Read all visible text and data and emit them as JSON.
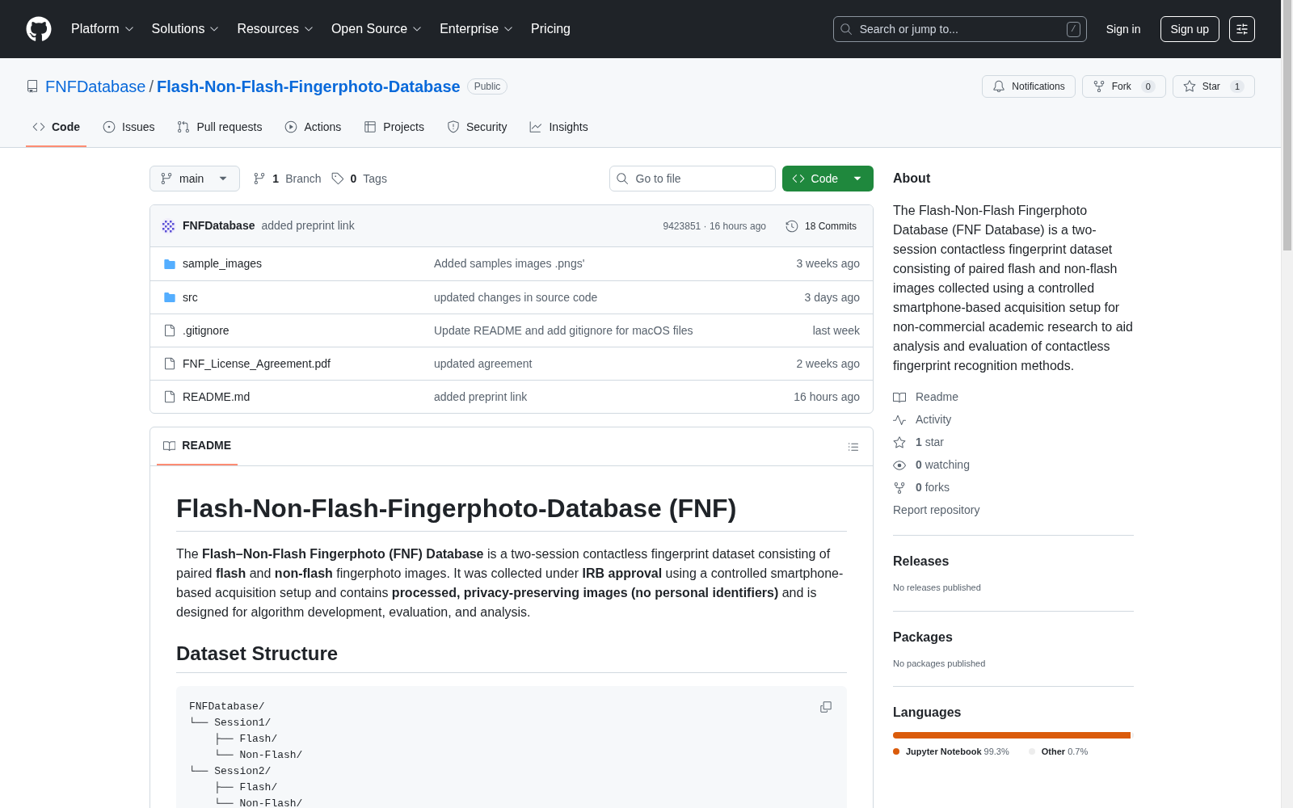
{
  "top_nav": {
    "items": [
      {
        "label": "Platform",
        "dropdown": true
      },
      {
        "label": "Solutions",
        "dropdown": true
      },
      {
        "label": "Resources",
        "dropdown": true
      },
      {
        "label": "Open Source",
        "dropdown": true
      },
      {
        "label": "Enterprise",
        "dropdown": true
      },
      {
        "label": "Pricing",
        "dropdown": false
      }
    ],
    "search": {
      "placeholder": "Search or jump to...",
      "shortcut": "/"
    },
    "sign_in": "Sign in",
    "sign_up": "Sign up"
  },
  "repo": {
    "owner": "FNFDatabase",
    "separator": "/",
    "name": "Flash-Non-Flash-Fingerphoto-Database",
    "visibility": "Public",
    "actions": [
      {
        "label": "Notifications",
        "kind": "bell"
      },
      {
        "label": "Fork",
        "count": "0",
        "kind": "fork"
      },
      {
        "label": "Star",
        "count": "1",
        "kind": "star"
      }
    ]
  },
  "tabs": [
    {
      "label": "Code",
      "kind": "code",
      "selected": true
    },
    {
      "label": "Issues",
      "kind": "issues",
      "selected": false
    },
    {
      "label": "Pull requests",
      "kind": "pulls",
      "selected": false
    },
    {
      "label": "Actions",
      "kind": "actions",
      "selected": false
    },
    {
      "label": "Projects",
      "kind": "projects",
      "selected": false
    },
    {
      "label": "Security",
      "kind": "security",
      "selected": false
    },
    {
      "label": "Insights",
      "kind": "insights",
      "selected": false
    }
  ],
  "toolbar": {
    "branch": "main",
    "branches_count": "1",
    "branches_label": "Branch",
    "tags_count": "0",
    "tags_label": "Tags",
    "go_to_file": {
      "placeholder": "Go to file"
    },
    "code_button": "Code"
  },
  "latest_commit": {
    "author": "FNFDatabase",
    "message": "added preprint link",
    "hash": "9423851",
    "separator": "·",
    "time": "16 hours ago",
    "commits": "18 Commits"
  },
  "files": [
    {
      "name": "sample_images",
      "kind": "folder",
      "message": "Added samples images .pngs'",
      "time": "3 weeks ago"
    },
    {
      "name": "src",
      "kind": "folder",
      "message": "updated changes in source code",
      "time": "3 days ago"
    },
    {
      "name": ".gitignore",
      "kind": "file",
      "message": "Update README and add gitignore for macOS files",
      "time": "last week"
    },
    {
      "name": "FNF_License_Agreement.pdf",
      "kind": "file",
      "message": "updated agreement",
      "time": "2 weeks ago"
    },
    {
      "name": "README.md",
      "kind": "file",
      "message": "added preprint link",
      "time": "16 hours ago"
    }
  ],
  "readme": {
    "tab": "README",
    "title": "Flash-Non-Flash-Fingerphoto-Database (FNF)",
    "intro": "The **Flash–Non-Flash Fingerphoto (FNF) Database** is a two-session contactless fingerprint dataset consisting of paired **flash** and **non-flash** fingerphoto images. It was collected under **IRB approval** using a controlled smartphone-based acquisition setup and contains **processed, privacy-preserving images (no personal identifiers)** and is designed for algorithm development, evaluation, and analysis.",
    "section_title": "Dataset Structure",
    "code_lines": [
      "FNFDatabase/",
      "└── Session1/",
      "    ├── Flash/",
      "    └── Non-Flash/",
      "└── Session2/",
      "    ├── Flash/",
      "    └── Non-Flash/"
    ]
  },
  "about": {
    "title": "About",
    "description": "The Flash-Non-Flash Fingerphoto Database (FNF Database) is a two-session contactless fingerprint dataset consisting of paired flash and non-flash images collected using a controlled smartphone-based acquisition setup for non-commercial academic research to aid analysis and evaluation of contactless fingerprint recognition methods.",
    "links": [
      {
        "kind": "readme",
        "label": "Readme"
      },
      {
        "kind": "activity",
        "label": "Activity"
      },
      {
        "kind": "star",
        "count": "1",
        "label": "star"
      },
      {
        "kind": "watch",
        "count": "0",
        "label": "watching"
      },
      {
        "kind": "fork",
        "count": "0",
        "label": "forks"
      }
    ],
    "report": "Report repository"
  },
  "releases": {
    "title": "Releases",
    "note": "No releases published"
  },
  "packages": {
    "title": "Packages",
    "note": "No packages published"
  },
  "languages": {
    "title": "Languages",
    "items": [
      {
        "name": "Jupyter Notebook",
        "percent": "99.3%",
        "level": 0.993,
        "color": "#da5b0b"
      },
      {
        "name": "Other",
        "percent": "0.7%",
        "level": 0.007,
        "color": "#ededed"
      }
    ]
  }
}
